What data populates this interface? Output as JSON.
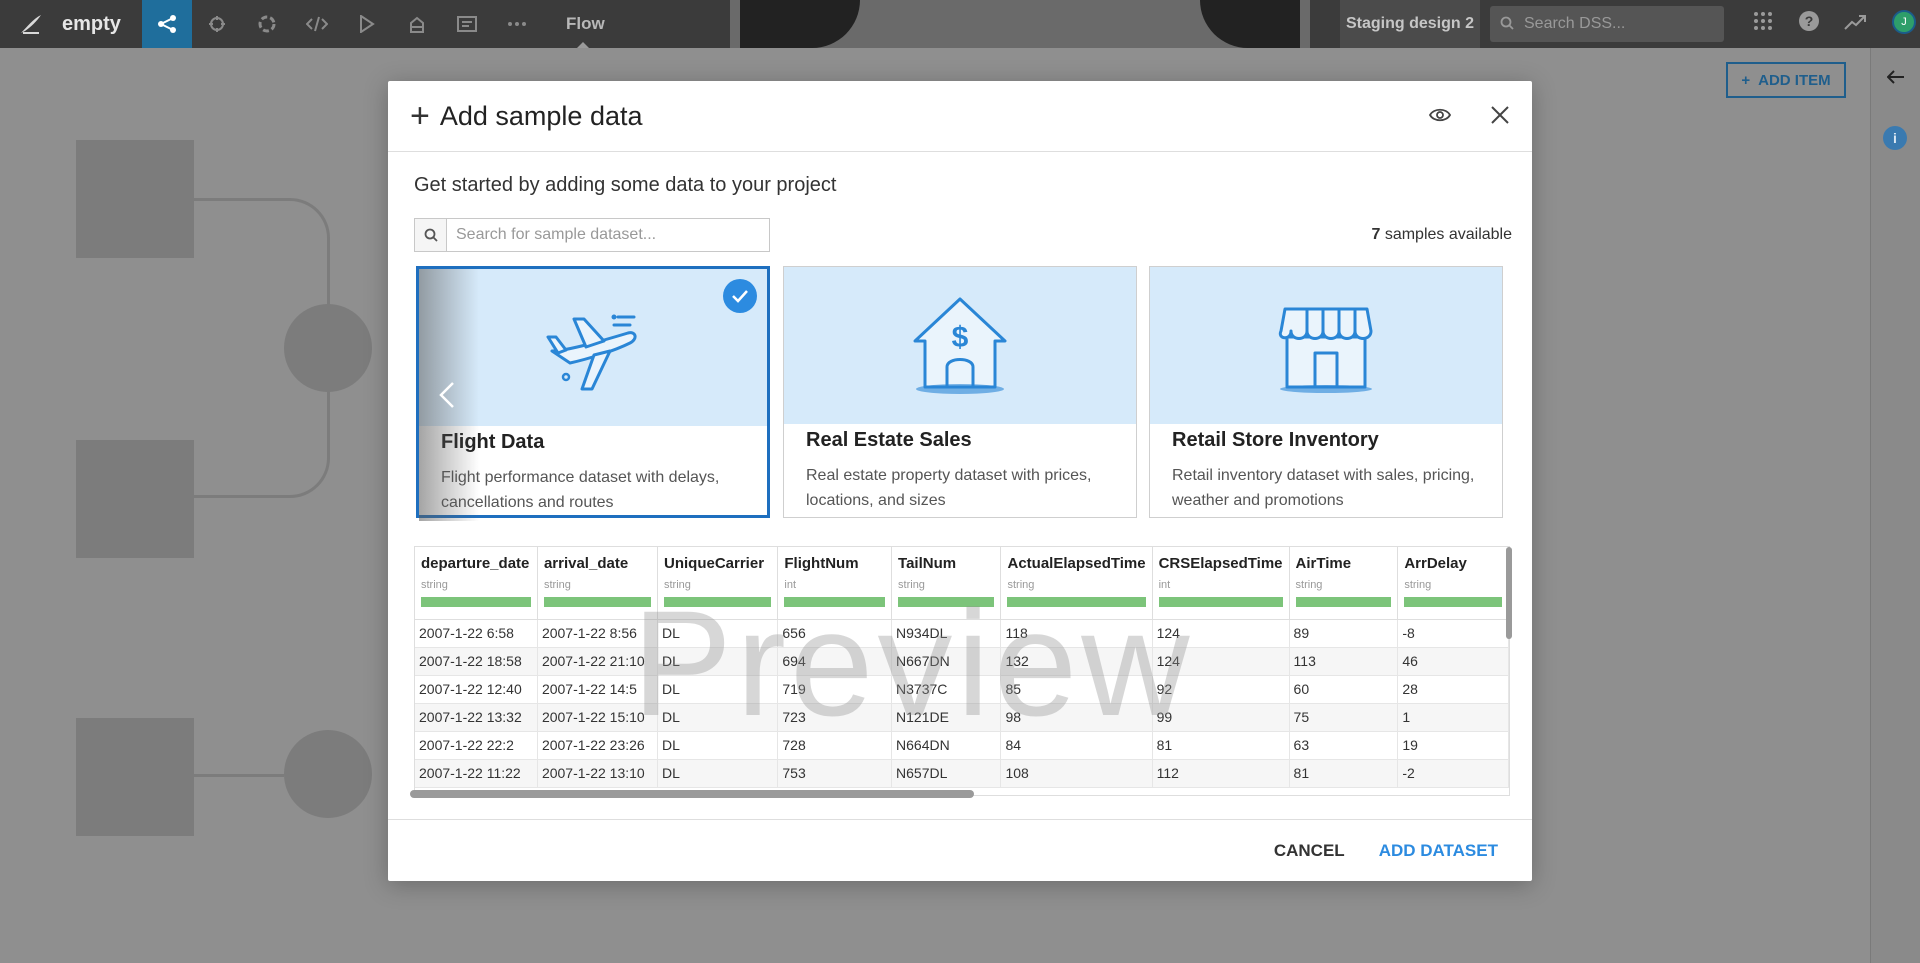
{
  "topbar": {
    "project_name": "empty",
    "nav_flow_label": "Flow",
    "staging_label": "Staging design 2",
    "search_placeholder": "Search DSS...",
    "avatar_initial": "J",
    "nav_icons": [
      "flow-icon",
      "lab-icon",
      "automation-icon",
      "code-icon",
      "run-icon",
      "library-icon",
      "dashboard-icon",
      "more-icon"
    ]
  },
  "canvas": {
    "add_item_label": "ADD ITEM"
  },
  "modal": {
    "title": "Add sample data",
    "subtitle": "Get started by adding some data to your project",
    "search_placeholder": "Search for sample dataset...",
    "samples_count": "7",
    "samples_label": "samples available",
    "cards": [
      {
        "title": "Flight Data",
        "description": "Flight performance dataset with delays, cancellations and routes",
        "icon": "airplane-icon",
        "selected": true
      },
      {
        "title": "Real Estate Sales",
        "description": "Real estate property dataset with prices, locations, and sizes",
        "icon": "house-dollar-icon",
        "selected": false
      },
      {
        "title": "Retail Store Inventory",
        "description": "Retail inventory dataset with sales, pricing, weather and promotions",
        "icon": "store-icon",
        "selected": false
      }
    ],
    "preview_watermark": "Preview",
    "columns": [
      {
        "name": "departure_date",
        "type": "string"
      },
      {
        "name": "arrival_date",
        "type": "string"
      },
      {
        "name": "UniqueCarrier",
        "type": "string"
      },
      {
        "name": "FlightNum",
        "type": "int"
      },
      {
        "name": "TailNum",
        "type": "string"
      },
      {
        "name": "ActualElapsedTime",
        "type": "string"
      },
      {
        "name": "CRSElapsedTime",
        "type": "int"
      },
      {
        "name": "AirTime",
        "type": "string"
      },
      {
        "name": "ArrDelay",
        "type": "string"
      }
    ],
    "rows": [
      [
        "2007-1-22 6:58",
        "2007-1-22 8:56",
        "DL",
        "656",
        "N934DL",
        "118",
        "124",
        "89",
        "-8"
      ],
      [
        "2007-1-22 18:58",
        "2007-1-22 21:10",
        "DL",
        "694",
        "N667DN",
        "132",
        "124",
        "113",
        "46"
      ],
      [
        "2007-1-22 12:40",
        "2007-1-22 14:5",
        "DL",
        "719",
        "N3737C",
        "85",
        "92",
        "60",
        "28"
      ],
      [
        "2007-1-22 13:32",
        "2007-1-22 15:10",
        "DL",
        "723",
        "N121DE",
        "98",
        "99",
        "75",
        "1"
      ],
      [
        "2007-1-22 22:2",
        "2007-1-22 23:26",
        "DL",
        "728",
        "N664DN",
        "84",
        "81",
        "63",
        "19"
      ],
      [
        "2007-1-22 11:22",
        "2007-1-22 13:10",
        "DL",
        "753",
        "N657DL",
        "108",
        "112",
        "81",
        "-2"
      ]
    ],
    "footer": {
      "cancel_label": "CANCEL",
      "add_label": "ADD DATASET"
    }
  },
  "colors": {
    "accent": "#2c8be0",
    "card_art_bg": "#d6eafa",
    "type_bar": "#7cc47a",
    "nav_active": "#1f6e9c"
  }
}
